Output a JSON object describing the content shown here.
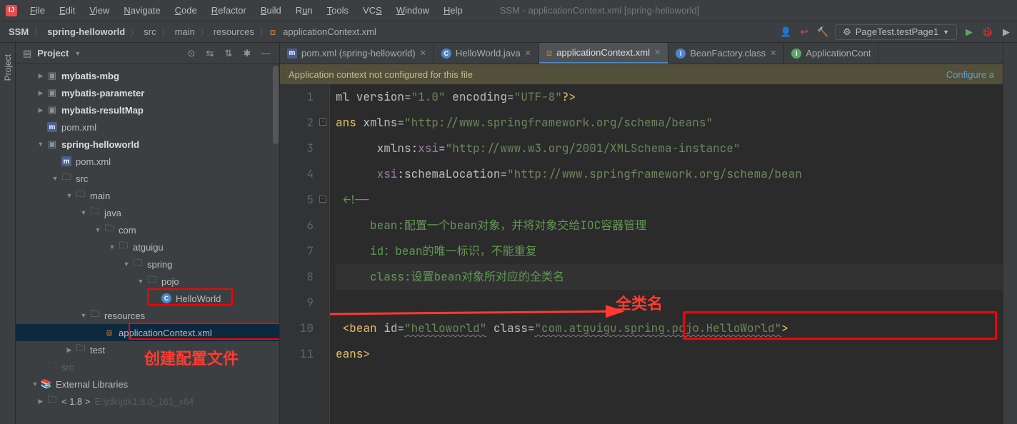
{
  "menu": {
    "items": [
      "File",
      "Edit",
      "View",
      "Navigate",
      "Code",
      "Refactor",
      "Build",
      "Run",
      "Tools",
      "VCS",
      "Window",
      "Help"
    ],
    "windowTitle": "SSM - applicationContext.xml [spring-helloworld]"
  },
  "breadcrumbs": [
    "SSM",
    "spring-helloworld",
    "src",
    "main",
    "resources",
    "applicationContext.xml"
  ],
  "runConfig": "PageTest.testPage1",
  "projectTool": {
    "title": "Project"
  },
  "tree": {
    "mybatisMbg": "mybatis-mbg",
    "mybatisParameter": "mybatis-parameter",
    "mybatisResultMap": "mybatis-resultMap",
    "pom1": "pom.xml",
    "springHw": "spring-helloworld",
    "pom2": "pom.xml",
    "src": "src",
    "main": "main",
    "java": "java",
    "com": "com",
    "atguigu": "atguigu",
    "spring": "spring",
    "pojo": "pojo",
    "helloWorld": "HelloWorld",
    "resources": "resources",
    "appCtx": "applicationContext.xml",
    "test": "test",
    "srcGrey": "src",
    "extLib": "External Libraries",
    "jdk": "< 1.8 >",
    "jdkPath": "E:\\jdk\\jdk1.8.0_161_x64"
  },
  "tabs": {
    "t1": "pom.xml (spring-helloworld)",
    "t2": "HelloWorld.java",
    "t3": "applicationContext.xml",
    "t4": "BeanFactory.class",
    "t5": "ApplicationCont"
  },
  "notification": {
    "msg": "Application context not configured for this file",
    "link": "Configure a"
  },
  "code": {
    "l1a": "ml version=",
    "l1b": "\"1.0\"",
    "l1c": " encoding=",
    "l1d": "\"UTF-8\"",
    "l1e": "?>",
    "l2a": "ans ",
    "l2b": "xmlns",
    "l2c": "=",
    "l2d": "\"http://www.springframework.org/schema/beans\"",
    "l3a": "      ",
    "l3b": "xmlns:",
    "l3c": "xsi",
    "l3d": "=",
    "l3e": "\"http://www.w3.org/2001/XMLSchema-instance\"",
    "l4a": "      ",
    "l4b": "xsi",
    "l4c": ":schemaLocation=",
    "l4d": "\"http://www.springframework.org/schema/bean",
    "l5": " <!--",
    "l6": "     bean:配置一个bean对象，并将对象交给IOC容器管理",
    "l7": "     id：bean的唯一标识，不能重复",
    "l8": "     class:设置bean对象所对应的全类名",
    "l10a": " <",
    "l10b": "bean ",
    "l10c": "id",
    "l10d": "=",
    "l10e": "\"helloworld\"",
    "l10f": " class",
    "l10g": "=",
    "l10h": "\"com.atguigu.spring.pojo.HelloWorld\"",
    "l10i": ">",
    "l11": "eans>"
  },
  "annotations": {
    "fullClassName": "全类名",
    "createConfig": "创建配置文件"
  },
  "lineNumbers": [
    "1",
    "2",
    "3",
    "4",
    "5",
    "6",
    "7",
    "8",
    "9",
    "10",
    "11"
  ]
}
